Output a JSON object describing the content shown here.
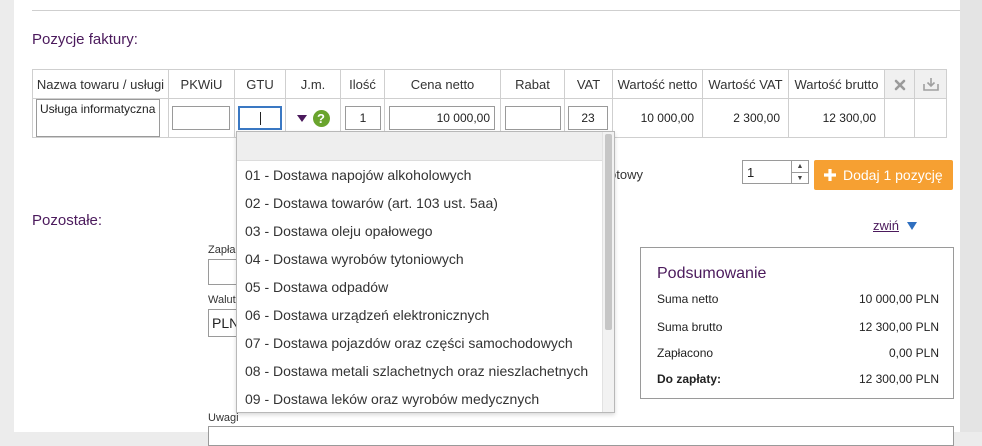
{
  "sections": {
    "items_title": "Pozycje faktury:",
    "other_title": "Pozostałe:"
  },
  "table": {
    "headers": [
      "Nazwa towaru / usługi",
      "PKWiU",
      "GTU",
      "J.m.",
      "Ilość",
      "Cena netto",
      "Rabat",
      "VAT",
      "Wartość netto",
      "Wartość VAT",
      "Wartość brutto"
    ],
    "row": {
      "name": "Usługa informatyczna",
      "pkwiu": "",
      "gtu": "",
      "quantity": "1",
      "unit_price": "10 000,00",
      "discount": "",
      "vat": "23",
      "net_value": "10 000,00",
      "vat_value": "2 300,00",
      "gross_value": "12 300,00"
    }
  },
  "gtu_dropdown": {
    "options": [
      "01 - Dostawa napojów alkoholowych",
      "02 - Dostawa towarów (art. 103 ust. 5aa)",
      "03 - Dostawa oleju opałowego",
      "04 - Dostawa wyrobów tytoniowych",
      "05 - Dostawa odpadów",
      "06 - Dostawa urządzeń elektronicznych",
      "07 - Dostawa pojazdów oraz części samochodowych",
      "08 - Dostawa metali szlachetnych oraz nieszlachetnych",
      "09 - Dostawa leków oraz wyrobów medycznych"
    ]
  },
  "add_row": {
    "partial_label": "otowy",
    "count": "1",
    "button_label": "Dodaj 1 pozycję"
  },
  "other": {
    "paid_label_partial": "Zapła",
    "currency_label_partial": "Walut",
    "currency_value_partial": "PLN",
    "notes_label": "Uwagi",
    "collapse_link": "zwiń"
  },
  "summary": {
    "title": "Podsumowanie",
    "rows": [
      {
        "label": "Suma netto",
        "value": "10 000,00 PLN"
      },
      {
        "label": "Suma brutto",
        "value": "12 300,00 PLN"
      },
      {
        "label": "Zapłacono",
        "value": "0,00 PLN"
      },
      {
        "label": "Do zapłaty:",
        "value": "12 300,00 PLN"
      }
    ]
  },
  "icons": {
    "delete": "close-icon",
    "save": "save-icon",
    "help": "help-icon",
    "add": "plus-icon"
  },
  "colors": {
    "accent": "#4b1a5c",
    "button": "#f6a032",
    "focus": "#3a78c3",
    "help": "#6aa42d"
  }
}
